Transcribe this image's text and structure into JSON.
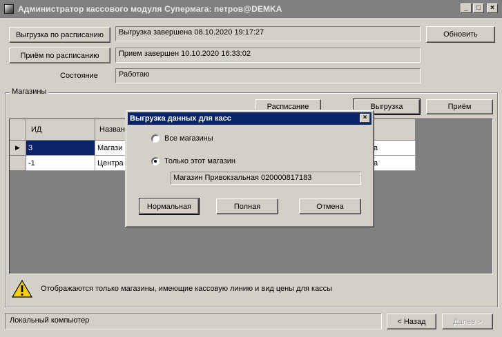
{
  "window": {
    "title": "Администратор кассового модуля Супермага: петров@DEMKA",
    "minimize": "_",
    "maximize": "□",
    "close": "×"
  },
  "top": {
    "upload_schedule_label": "Выгрузка по расписанию",
    "upload_status": "Выгрузка завершена 08.10.2020 19:17:27",
    "receive_schedule_label": "Приём по расписанию",
    "receive_status": "Прием завершен 10.10.2020 16:33:02",
    "state_label": "Состояние",
    "state_value": "Работаю",
    "refresh_label": "Обновить"
  },
  "stores": {
    "group_caption": "Магазины",
    "schedule_button": "Расписание",
    "upload_button": "Выгрузка",
    "receive_button": "Приём",
    "columns": [
      "ИД",
      "Назван"
    ],
    "rows": [
      {
        "indicator": "▶",
        "id": "3",
        "name": "Магази",
        "extra": "а"
      },
      {
        "indicator": "",
        "id": "-1",
        "name": "Центра",
        "extra": "а"
      }
    ],
    "warning_text": "Отображаются только магазины, имеющие кассовую линию и вид цены для кассы"
  },
  "status": {
    "computer": "Локальный компьютер",
    "back_button": "< Назад",
    "next_button": "Далее >"
  },
  "dialog": {
    "title": "Выгрузка данных для касс",
    "close": "×",
    "option_all": "Все магазины",
    "option_this": "Только этот магазин",
    "store_field": "Магазин Привокзальная 020000817183",
    "selected_option": "option_this",
    "normal_button": "Нормальная",
    "full_button": "Полная",
    "cancel_button": "Отмена"
  }
}
